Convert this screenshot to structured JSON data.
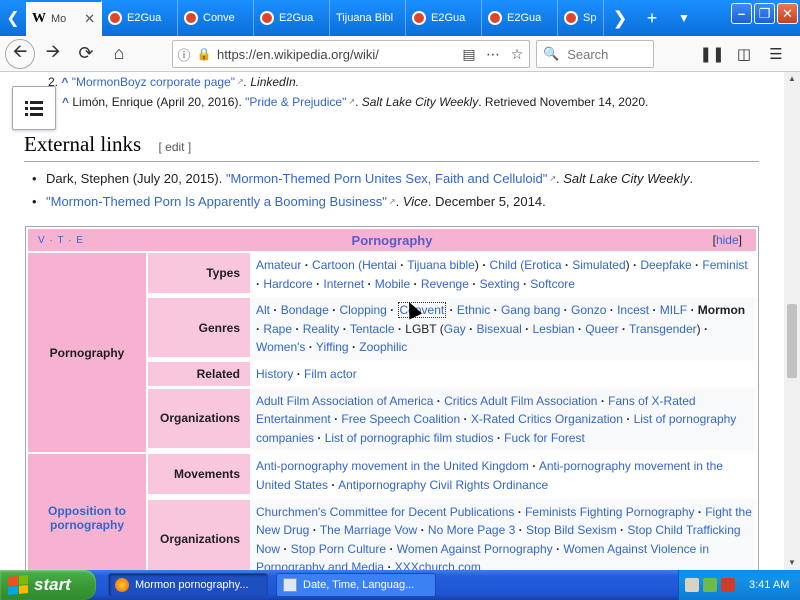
{
  "browser": {
    "tabs": [
      {
        "label": "Mo",
        "favicon": "wikipedia-icon",
        "active": true
      },
      {
        "label": "E2Gua",
        "favicon": "firefox-red-icon"
      },
      {
        "label": "Conve",
        "favicon": "firefox-red-icon"
      },
      {
        "label": "E2Gua",
        "favicon": "firefox-red-icon"
      },
      {
        "label": "Tijuana Bibl",
        "favicon": ""
      },
      {
        "label": "E2Gua",
        "favicon": "firefox-red-icon"
      },
      {
        "label": "E2Gua",
        "favicon": "firefox-red-icon"
      },
      {
        "label": "Sp",
        "favicon": "firefox-red-icon"
      }
    ],
    "url": "https://en.wikipedia.org/wiki/",
    "search_placeholder": "Search"
  },
  "references": {
    "r2": {
      "num": "2.",
      "caret": "^",
      "link": "\"MormonBoyz corporate page\"",
      "rest": ". LinkedIn."
    },
    "r3": {
      "caret": "^",
      "pre": "Limón, Enrique (April 20, 2016). ",
      "link": "\"Pride & Prejudice\"",
      "mid": ". ",
      "pub": "Salt Lake City Weekly",
      "post": ". Retrieved November 14, 2020."
    }
  },
  "section": {
    "title": "External links",
    "edit": "[ edit ]"
  },
  "external_links": {
    "l1": {
      "pre": "Dark, Stephen (July 20, 2015). ",
      "link": "\"Mormon-Themed Porn Unites Sex, Faith and Celluloid\"",
      "mid": ". ",
      "pub": "Salt Lake City Weekly",
      "post": "."
    },
    "l2": {
      "link": "\"Mormon-Themed Porn Is Apparently a Booming Business\"",
      "mid": ". ",
      "pub": "Vice",
      "post": ". December 5, 2014."
    }
  },
  "navbox": {
    "vte": "V · T · E",
    "title": "Pornography",
    "hide": "[hide]",
    "groups": {
      "pornography": "Pornography",
      "opposition": "Opposition to pornography"
    },
    "rows": {
      "types": {
        "label": "Types",
        "items": [
          "Amateur",
          "Cartoon (",
          "Hentai",
          "Tijuana bible",
          ")",
          "Child (",
          "Erotica",
          "Simulated",
          ")",
          "Deepfake",
          "Feminist",
          "Hardcore",
          "Internet",
          "Mobile",
          "Revenge",
          "Sexting",
          "Softcore"
        ]
      },
      "genres": {
        "label": "Genres",
        "items": [
          "Alt",
          "Bondage",
          "Clopping",
          "Convent",
          "Ethnic",
          "Gang bang",
          "Gonzo",
          "Incest",
          "MILF",
          "Mormon",
          "Rape",
          "Reality",
          "Tentacle",
          "LGBT (",
          "Gay",
          "Bisexual",
          "Lesbian",
          "Queer",
          "Transgender",
          ")",
          "Women's",
          "Yiffing",
          "Zoophilic"
        ]
      },
      "related": {
        "label": "Related",
        "items": [
          "History",
          "Film actor"
        ]
      },
      "organizations1": {
        "label": "Organizations",
        "items": [
          "Adult Film Association of America",
          "Critics Adult Film Association",
          "Fans of X-Rated Entertainment",
          "Free Speech Coalition",
          "X-Rated Critics Organization",
          "List of pornography companies",
          "List of pornographic film studios",
          "Fuck for Forest"
        ]
      },
      "movements": {
        "label": "Movements",
        "items": [
          "Anti-pornography movement in the United Kingdom",
          "Anti-pornography movement in the United States",
          "Antipornography Civil Rights Ordinance"
        ]
      },
      "organizations2": {
        "label": "Organizations",
        "items": [
          "Churchmen's Committee for Decent Publications",
          "Feminists Fighting Pornography",
          "Fight the New Drug",
          "The Marriage Vow",
          "No More Page 3",
          "Stop Bild Sexism",
          "Stop Child Trafficking Now",
          "Stop Porn Culture",
          "Women Against Pornography",
          "Women Against Violence in Pornography and Media",
          "XXXchurch.com"
        ]
      }
    }
  },
  "taskbar": {
    "start": "start",
    "windows": [
      {
        "label": "Mormon pornography..."
      },
      {
        "label": "Date, Time, Languag..."
      }
    ],
    "clock": "3:41 AM"
  },
  "colors": {
    "accent": "#0a84ff",
    "link": "#3366cc",
    "navbox_title": "#f6b3d1",
    "navbox_group": "#f8c7dd"
  }
}
